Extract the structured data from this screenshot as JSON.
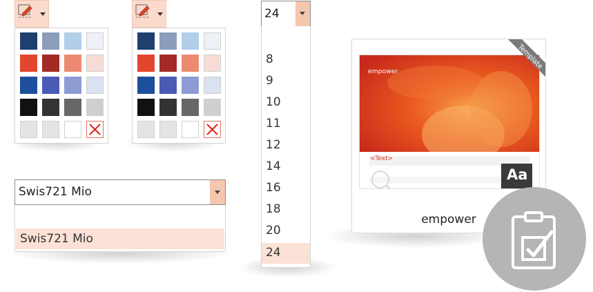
{
  "color_pickers": [
    {
      "icon": "pencil-icon"
    },
    {
      "icon": "pencil-icon"
    }
  ],
  "palette": {
    "rows": [
      [
        "#1f3f6e",
        "#8b9dbb",
        "#b2cfe9",
        "#edf0f6"
      ],
      [
        "#e2462f",
        "#a42a26",
        "#ed8b72",
        "#f7dcd6"
      ],
      [
        "#1d4f9c",
        "#4a5bb5",
        "#8d9bd4",
        "#dae2f1"
      ],
      [
        "#111111",
        "#333333",
        "#676767",
        "#cfcfcf"
      ],
      [
        "#e4e4e4",
        "#e4e4e4",
        "#ffffff",
        "none"
      ]
    ]
  },
  "font_selector": {
    "value": "Swis721 Mio",
    "options": [
      "Swis721 Mio"
    ],
    "selected_option": "Swis721 Mio"
  },
  "size_selector": {
    "value": "24",
    "options": [
      "8",
      "9",
      "10",
      "11",
      "12",
      "14",
      "16",
      "18",
      "20",
      "24"
    ],
    "selected_option": "24"
  },
  "template": {
    "badge": "Template",
    "logo": "empower",
    "placeholder_text": "<Text>",
    "theme_glyph": "Aa",
    "name": "empower"
  },
  "colors": {
    "accent": "#f5c7ae",
    "selection": "#fbe1d6",
    "template_orange": "#e8581c"
  }
}
